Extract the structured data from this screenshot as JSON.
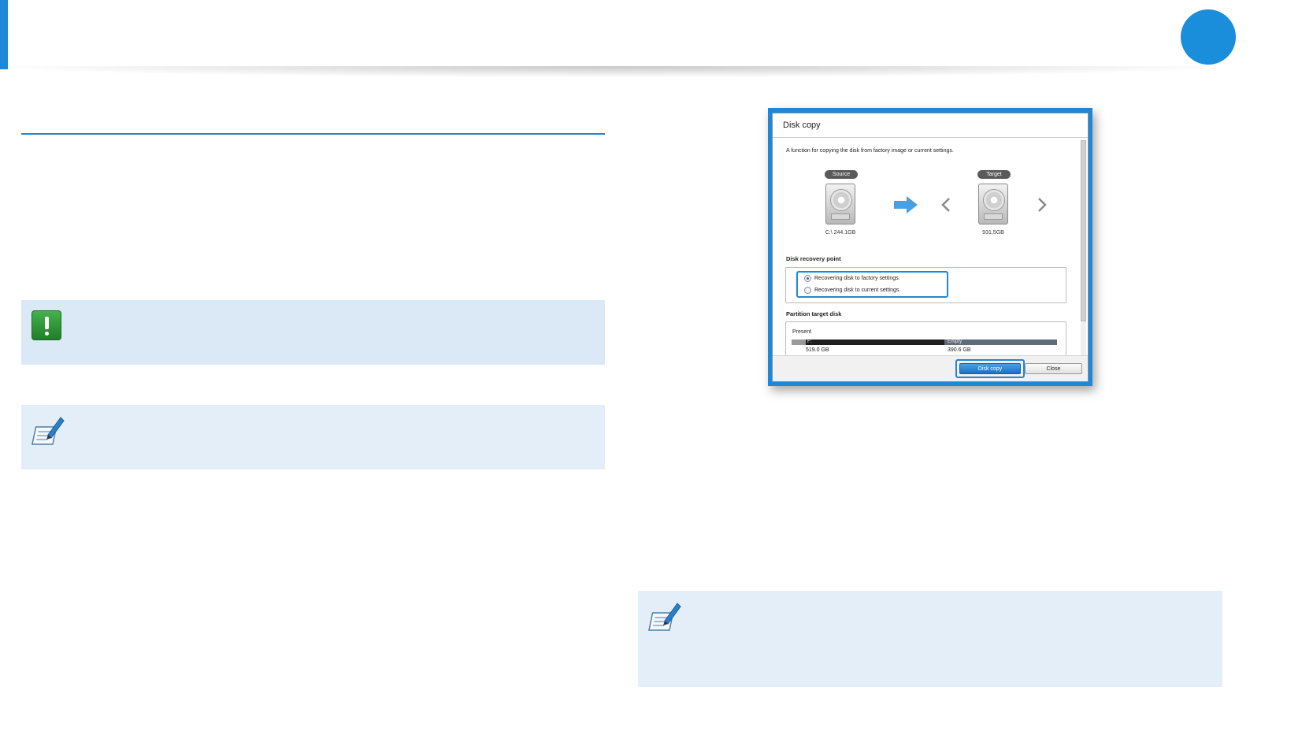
{
  "dialog": {
    "title": "Disk copy",
    "description": "A function for copying the disk from factory image or current settings.",
    "source": {
      "badge": "Source",
      "label": "C:\\ 244.1GB"
    },
    "target": {
      "badge": "Target",
      "label": "931.5GB"
    },
    "recovery_point": {
      "heading": "Disk recovery point",
      "options": [
        {
          "label": "Recovering disk to factory settings.",
          "selected": true
        },
        {
          "label": "Recovering disk to current settings.",
          "selected": false
        }
      ]
    },
    "partition": {
      "heading": "Partition target disk",
      "row_label": "Present",
      "segments": [
        {
          "name": "F:",
          "size": "519.0 GB"
        },
        {
          "name": "Empty",
          "size": "390.6 GB"
        }
      ]
    },
    "buttons": {
      "primary": "Disk copy",
      "close": "Close"
    }
  },
  "colors": {
    "accent": "#1f87d6",
    "note_bg": "#e3eef9",
    "caution_green": "#2e9a36"
  },
  "icons": {
    "caution": "exclamation-icon",
    "tip": "memo-pencil-icon",
    "next": "chevron-right-icon",
    "prev": "chevron-left-icon",
    "copy": "arrow-right-icon"
  }
}
